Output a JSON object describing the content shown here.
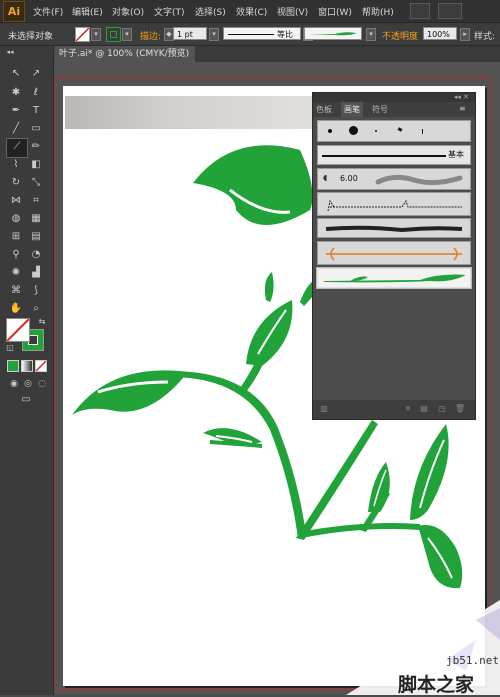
{
  "app": {
    "logo": "Ai"
  },
  "menu": {
    "items": [
      "文件(F)",
      "编辑(E)",
      "对象(O)",
      "文字(T)",
      "选择(S)",
      "效果(C)",
      "视图(V)",
      "窗口(W)",
      "帮助(H)"
    ]
  },
  "control_bar": {
    "selection_status": "未选择对象",
    "stroke_label": "描边:",
    "stroke_value": "1 pt",
    "stroke_profile": "等比",
    "opacity_label": "不透明度",
    "opacity_value": "100%",
    "style_label": "样式:"
  },
  "document_tab": {
    "title": "叶子.ai* @ 100% (CMYK/预览)"
  },
  "brush_panel": {
    "tabs": [
      "色板",
      "画笔",
      "符号"
    ],
    "active_tab": "画笔",
    "basic_brush_label": "基本",
    "brush_size_label": "6.00"
  },
  "watermark": {
    "site": "jb51.net",
    "name": "脚本之家"
  },
  "colors": {
    "leaf_green": "#21a33a",
    "accent_orange": "#f7a21c",
    "artboard_border": "#b03030"
  }
}
